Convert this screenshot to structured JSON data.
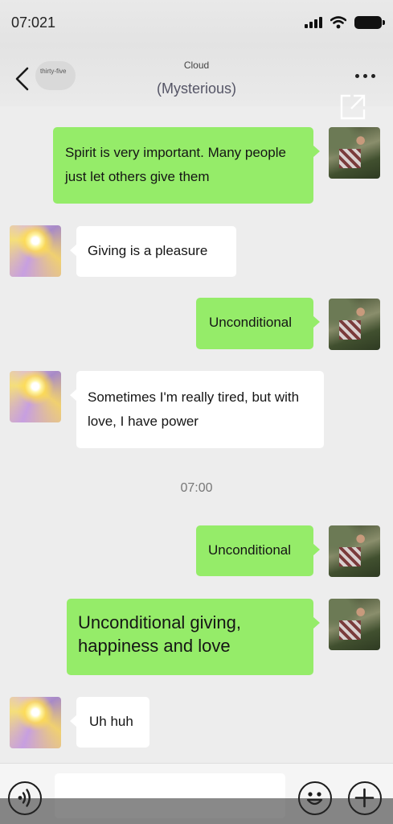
{
  "status_bar": {
    "time": "07:021"
  },
  "nav": {
    "back_label": "thirty-five",
    "subtitle": "Cloud",
    "title": "(Mysterious)"
  },
  "messages": [
    {
      "from": "me",
      "text": "Spirit is very important. Many people just let others give them"
    },
    {
      "from": "other",
      "text": "Giving is a pleasure"
    },
    {
      "from": "me",
      "text": "Unconditional"
    },
    {
      "from": "other",
      "text": "Sometimes I'm really tired, but with love, I have power"
    },
    {
      "from": "me",
      "text": "Unconditional"
    },
    {
      "from": "me",
      "text": "Unconditional giving, happiness and love"
    },
    {
      "from": "other",
      "text": "Uh huh"
    }
  ],
  "timestamp": "07:00",
  "colors": {
    "my_bubble": "#95ec69",
    "their_bubble": "#ffffff",
    "background": "#ededed"
  },
  "icons": [
    "back-icon",
    "more-icon",
    "share-icon",
    "voice-icon",
    "emoji-icon",
    "plus-icon"
  ]
}
